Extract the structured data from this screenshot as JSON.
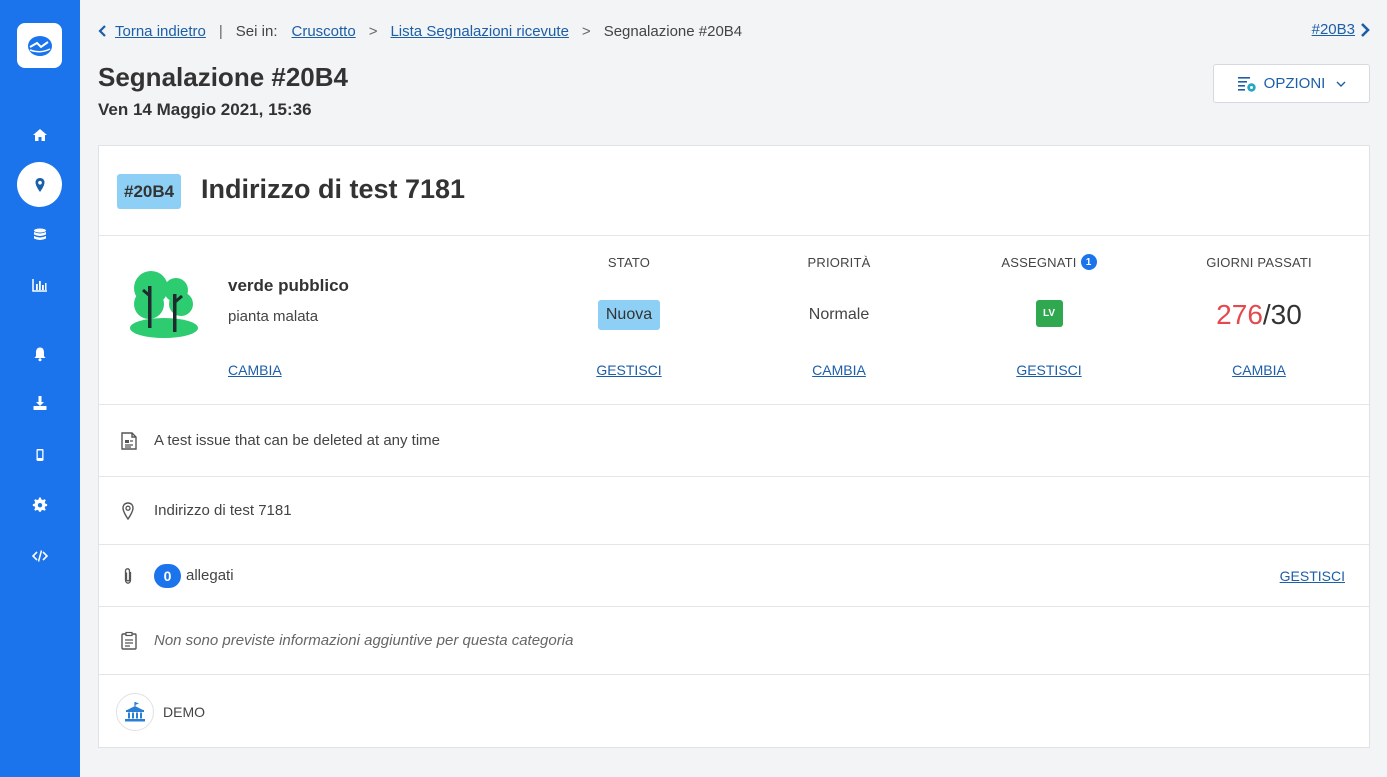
{
  "breadcrumb": {
    "back_label": "Torna indietro",
    "separator": "|",
    "location_label": "Sei in:",
    "items": [
      "Cruscotto",
      "Lista Segnalazioni ricevute",
      "Segnalazione #20B4"
    ],
    "chevron": ">"
  },
  "next_issue": {
    "label": "#20B3"
  },
  "page": {
    "title": "Segnalazione #20B4",
    "date": "Ven 14 Maggio 2021, 15:36"
  },
  "options_button": {
    "label": "OPZIONI"
  },
  "issue": {
    "id_badge": "#20B4",
    "title": "Indirizzo di test 7181",
    "category": "verde pubblico",
    "subcategory": "pianta malata",
    "category_action": "CAMBIA"
  },
  "columns": {
    "stato": {
      "header": "STATO",
      "value": "Nuova",
      "action": "GESTISCI"
    },
    "priorita": {
      "header": "PRIORITÀ",
      "value": "Normale",
      "action": "CAMBIA"
    },
    "assegnati": {
      "header": "ASSEGNATI",
      "count": "1",
      "initials": "LV",
      "action": "GESTISCI"
    },
    "giorni": {
      "header": "GIORNI PASSATI",
      "elapsed": "276",
      "limit": "/30",
      "action": "CAMBIA"
    }
  },
  "details": {
    "description": "A test issue that can be deleted at any time",
    "address": "Indirizzo di test 7181",
    "attachments_count": "0",
    "attachments_label": "allegati",
    "attachments_action": "GESTISCI",
    "extra_info": "Non sono previste informazioni aggiuntive per questa categoria",
    "organization": "DEMO"
  },
  "colors": {
    "sidebar": "#1b74ec",
    "link": "#1c5ea8",
    "badge": "#8ed0f5",
    "overdue": "#e5484d",
    "assignee": "#2fa84f"
  },
  "icons": {
    "sidebar": [
      "home-icon",
      "map-pin-icon",
      "database-icon",
      "chart-icon",
      "bell-icon",
      "download-icon",
      "mobile-icon",
      "gear-icon",
      "code-icon"
    ]
  }
}
